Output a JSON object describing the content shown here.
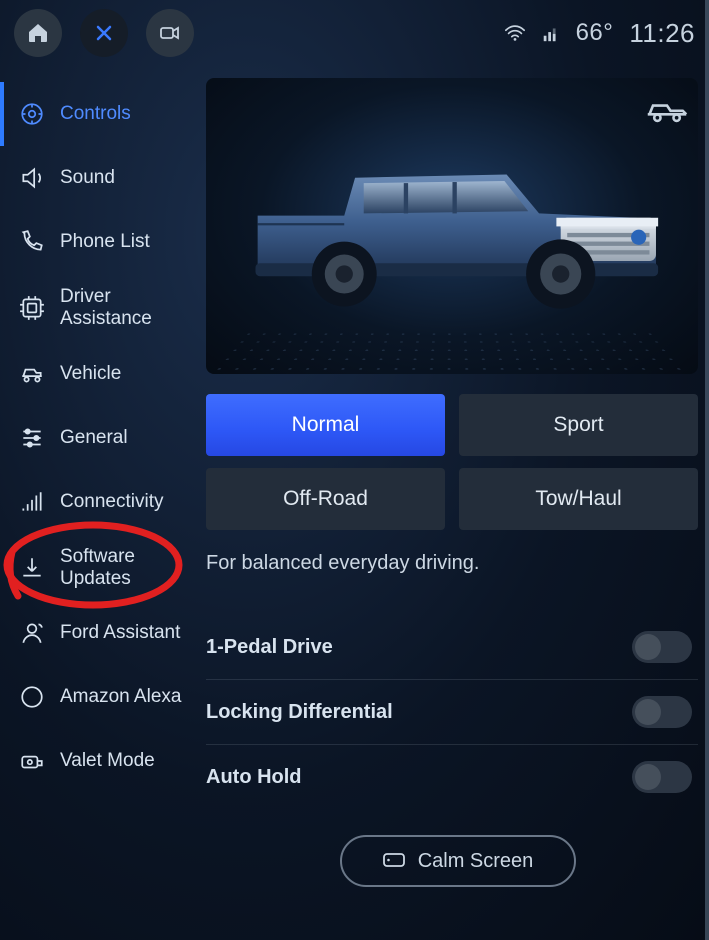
{
  "status": {
    "temperature": "66°",
    "time": "11:26"
  },
  "sidebar": {
    "items": [
      {
        "label": "Controls"
      },
      {
        "label": "Sound"
      },
      {
        "label": "Phone List"
      },
      {
        "label": "Driver Assistance"
      },
      {
        "label": "Vehicle"
      },
      {
        "label": "General"
      },
      {
        "label": "Connectivity"
      },
      {
        "label": "Software Updates"
      },
      {
        "label": "Ford Assistant"
      },
      {
        "label": "Amazon Alexa"
      },
      {
        "label": "Valet Mode"
      }
    ]
  },
  "drive_modes": {
    "options": [
      {
        "label": "Normal",
        "active": true
      },
      {
        "label": "Sport",
        "active": false
      },
      {
        "label": "Off-Road",
        "active": false
      },
      {
        "label": "Tow/Haul",
        "active": false
      }
    ],
    "description": "For balanced everyday driving."
  },
  "settings": [
    {
      "label": "1-Pedal Drive",
      "value": false
    },
    {
      "label": "Locking Differential",
      "value": false
    },
    {
      "label": "Auto Hold",
      "value": false
    }
  ],
  "calm_screen_label": "Calm Screen",
  "annotations": {
    "circled_item": "Software Updates"
  },
  "colors": {
    "accent": "#3a6dff",
    "annotation": "#e12020"
  }
}
